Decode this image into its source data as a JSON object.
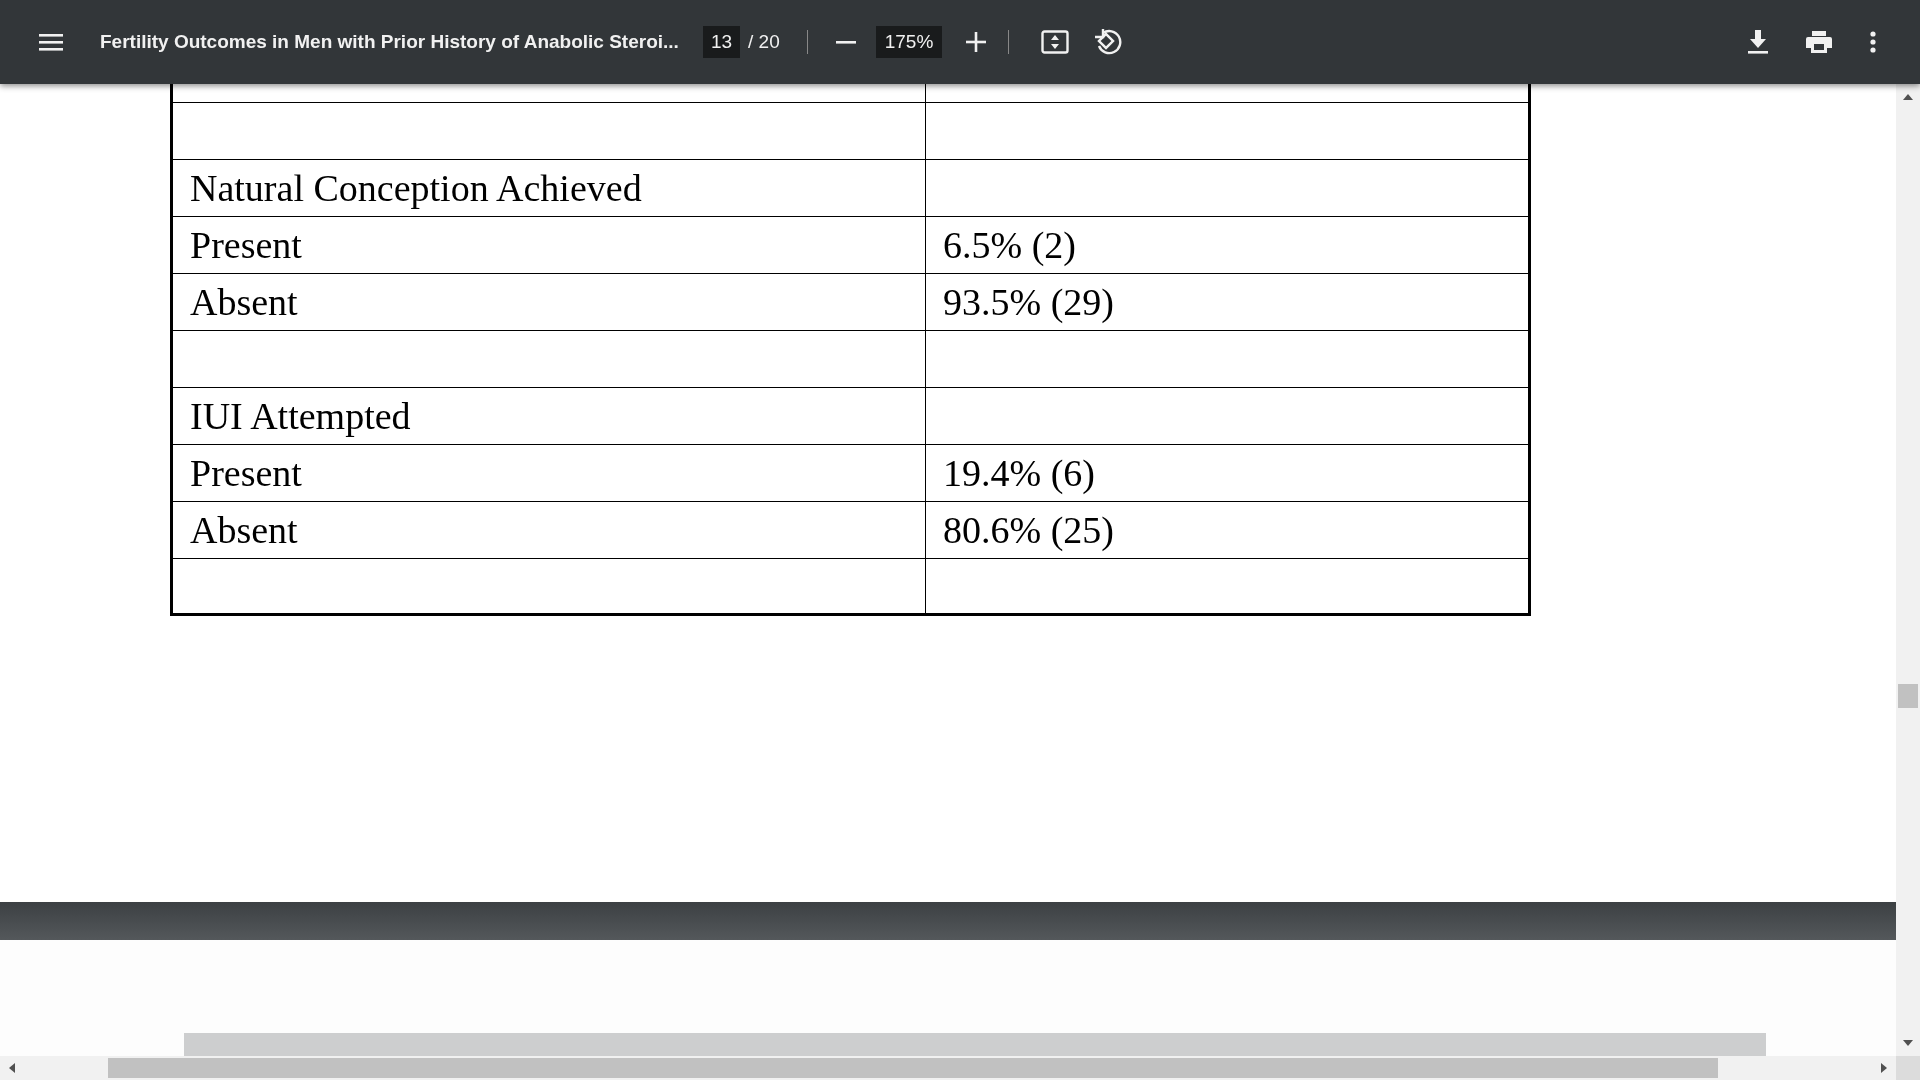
{
  "toolbar": {
    "title": "Fertility Outcomes in Men with Prior History of Anabolic Steroi...",
    "page": "13",
    "page_total": "/ 20",
    "zoom": "175%"
  },
  "table": {
    "rows": [
      {
        "kind": "clipped"
      },
      {
        "kind": "blank"
      },
      {
        "kind": "heading",
        "label": "Natural Conception Achieved"
      },
      {
        "kind": "data",
        "label": "Present",
        "value": "6.5% (2)"
      },
      {
        "kind": "data",
        "label": "Absent",
        "value": "93.5% (29)"
      },
      {
        "kind": "blank"
      },
      {
        "kind": "heading",
        "label": "IUI Attempted"
      },
      {
        "kind": "data",
        "label": "Present",
        "value": "19.4% (6)"
      },
      {
        "kind": "data",
        "label": "Absent",
        "value": "80.6% (25)"
      },
      {
        "kind": "blank"
      }
    ]
  }
}
